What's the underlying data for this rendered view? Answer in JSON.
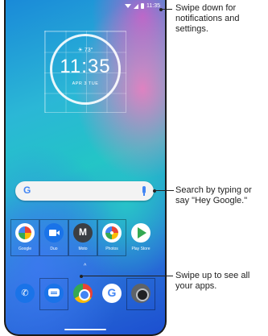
{
  "status_bar": {
    "time": "11:35"
  },
  "clock_widget": {
    "weather": "☀ 73°",
    "time": "11:35",
    "date": "APR 3 TUE"
  },
  "search_bar": {
    "logo": "G",
    "mic_icon": "microphone-icon"
  },
  "apps_row": [
    {
      "label": "Google",
      "icon": "google-folder-icon"
    },
    {
      "label": "Duo",
      "icon": "duo-icon"
    },
    {
      "label": "Moto",
      "icon": "moto-icon"
    },
    {
      "label": "Photos",
      "icon": "photos-icon"
    },
    {
      "label": "Play Store",
      "icon": "play-store-icon"
    }
  ],
  "dock": [
    {
      "icon": "phone-icon"
    },
    {
      "icon": "messages-icon"
    },
    {
      "icon": "chrome-icon"
    },
    {
      "icon": "google-icon"
    },
    {
      "icon": "camera-icon"
    }
  ],
  "callouts": {
    "notifications": "Swipe down for notifications and settings.",
    "search": "Search by typing or say \"Hey Google.\"",
    "apps": "Swipe up to see all your apps."
  }
}
